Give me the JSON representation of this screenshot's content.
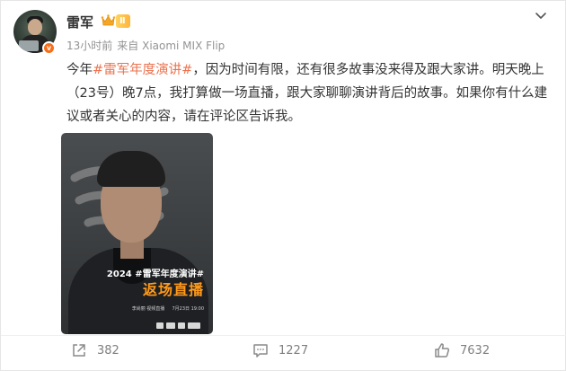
{
  "post": {
    "author": {
      "name": "雷军",
      "level_badge": "Ⅱ",
      "verified_badge": "v",
      "avatar_icon": "avatar",
      "crown_icon": "crown-icon"
    },
    "meta": {
      "time": "13小时前",
      "source": "来自 Xiaomi MIX Flip"
    },
    "content": {
      "prefix": "今年",
      "hashtag": "#雷军年度演讲#",
      "body": "，因为时间有限，还有很多故事没来得及跟大家讲。明天晚上（23号）晚7点，我打算做一场直播，跟大家聊聊演讲背后的故事。如果你有什么建议或者关心的内容，请在评论区告诉我。"
    },
    "image": {
      "subtitle": "2024 #雷军年度演讲#",
      "title": "返场直播",
      "info": "李尚丽 视频直播 　 7月23日 19:00",
      "logos": [
        "抖音",
        "小米",
        "抖音",
        "视频号"
      ]
    },
    "actions": {
      "repost_count": "382",
      "comment_count": "1227",
      "like_count": "7632"
    }
  },
  "colors": {
    "accent": "#eb7350",
    "verified": "#f76d1a",
    "level_badge": "#ffb43a",
    "meta_text": "#939393",
    "action_text": "#808080"
  }
}
